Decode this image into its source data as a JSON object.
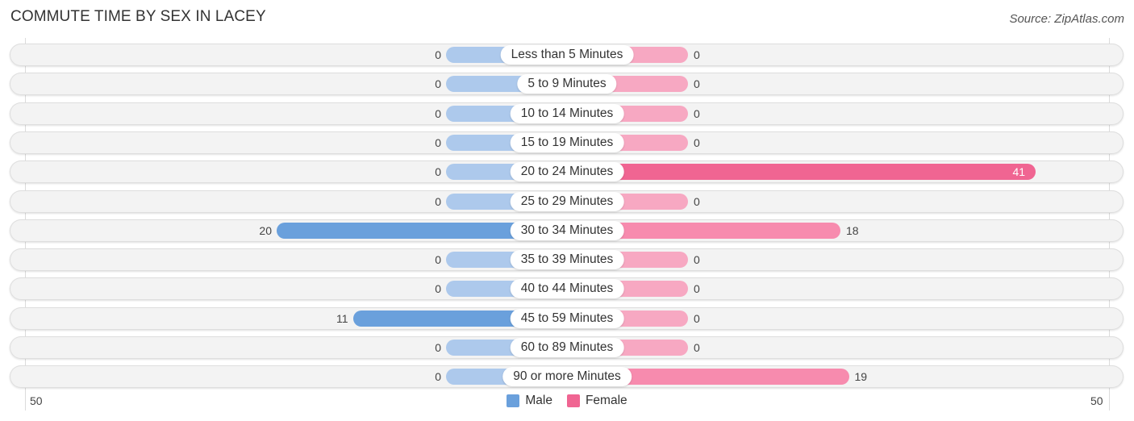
{
  "header": {
    "title": "COMMUTE TIME BY SEX IN LACEY",
    "source": "Source: ZipAtlas.com"
  },
  "colors": {
    "male": "#6aa0dc",
    "male_light": "#adc9ec",
    "female": "#f06592",
    "female_light": "#f7a8c2"
  },
  "chart_data": {
    "type": "bar",
    "orientation": "horizontal-diverging",
    "title": "COMMUTE TIME BY SEX IN LACEY",
    "categories": [
      "Less than 5 Minutes",
      "5 to 9 Minutes",
      "10 to 14 Minutes",
      "15 to 19 Minutes",
      "20 to 24 Minutes",
      "25 to 29 Minutes",
      "30 to 34 Minutes",
      "35 to 39 Minutes",
      "40 to 44 Minutes",
      "45 to 59 Minutes",
      "60 to 89 Minutes",
      "90 or more Minutes"
    ],
    "series": [
      {
        "name": "Male",
        "values": [
          0,
          0,
          0,
          0,
          0,
          0,
          20,
          0,
          0,
          11,
          0,
          0
        ]
      },
      {
        "name": "Female",
        "values": [
          0,
          0,
          0,
          0,
          41,
          0,
          18,
          0,
          0,
          0,
          0,
          19
        ]
      }
    ],
    "axis": {
      "left_tick": "50",
      "right_tick": "50",
      "range": [
        -50,
        50
      ]
    },
    "legend": {
      "position": "bottom-center",
      "entries": [
        "Male",
        "Female"
      ]
    }
  }
}
